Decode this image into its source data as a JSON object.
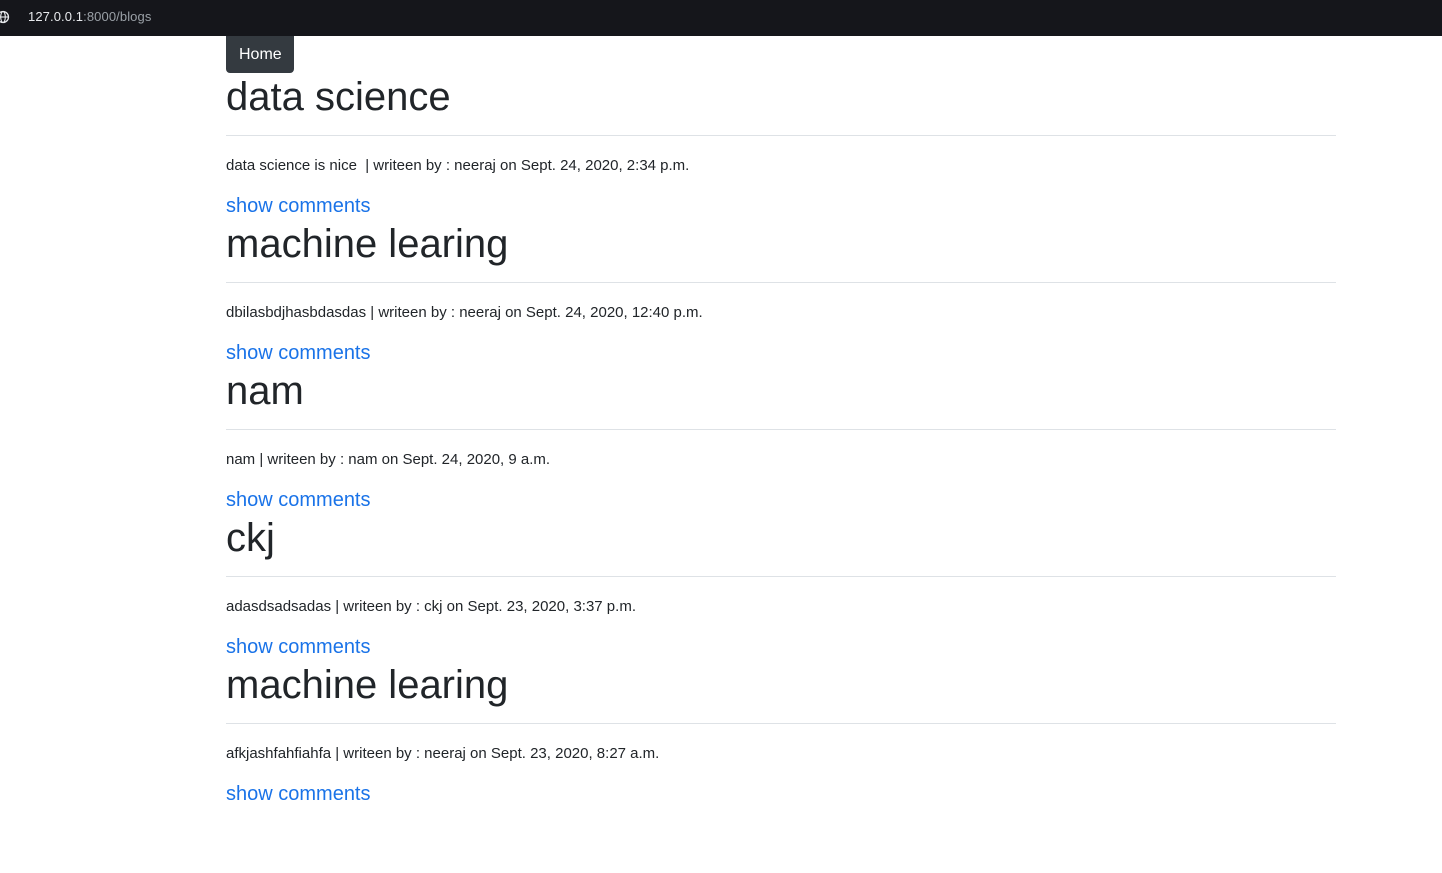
{
  "browser": {
    "url_host": "127.0.0.1",
    "url_path": ":8000/blogs"
  },
  "nav": {
    "home_label": "Home"
  },
  "posts": [
    {
      "title": "data science",
      "meta": "data science is nice  | writeen by : neeraj on Sept. 24, 2020, 2:34 p.m.",
      "link_label": "show comments"
    },
    {
      "title": "machine learing",
      "meta": "dbilasbdjhasbdasdas | writeen by : neeraj on Sept. 24, 2020, 12:40 p.m.",
      "link_label": "show comments"
    },
    {
      "title": "nam",
      "meta": "nam | writeen by : nam on Sept. 24, 2020, 9 a.m.",
      "link_label": "show comments"
    },
    {
      "title": "ckj",
      "meta": "adasdsadsadas | writeen by : ckj on Sept. 23, 2020, 3:37 p.m.",
      "link_label": "show comments"
    },
    {
      "title": "machine learing",
      "meta": "afkjashfahfiahfa | writeen by : neeraj on Sept. 23, 2020, 8:27 a.m.",
      "link_label": "show comments"
    }
  ]
}
